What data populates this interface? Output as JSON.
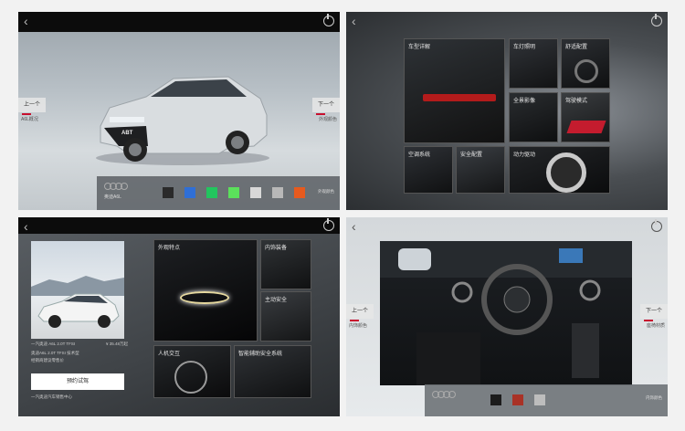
{
  "nav": {
    "prev": "上一个",
    "next": "下一个"
  },
  "panel1": {
    "left_sub": "A6L概况",
    "right_sub": "外观颜色",
    "brand": "奥迪A6L",
    "corner": "外观颜色",
    "grille_badge": "ABT",
    "swatches": [
      "#2a2a2a",
      "#2f6fd6",
      "#22c55e",
      "#5be05b",
      "#d8d8d8",
      "#b8b8b8",
      "#e65a1e"
    ]
  },
  "panel2": {
    "tiles": [
      {
        "label": "车型详解"
      },
      {
        "label": "车灯照明"
      },
      {
        "label": "舒适配置"
      },
      {
        "label": "全景影像"
      },
      {
        "label": "驾驶模式"
      },
      {
        "label": "空调系统"
      },
      {
        "label": "安全配置"
      },
      {
        "label": "动力驱动"
      }
    ]
  },
  "panel3": {
    "caption_left": "一汽奥迪 A6L 2.0T TFSI",
    "caption_right": "¥ 35.48万起",
    "info_lines": [
      "奥迪A6L 2.0T TFSI 技术型",
      "经销商建议零售价"
    ],
    "button": "预约试驾",
    "footer": "一汽奥迪汽车销售中心",
    "tiles": [
      {
        "label": "外观特点"
      },
      {
        "label": "内饰装备"
      },
      {
        "label": "主动安全"
      },
      {
        "label": "人机交互"
      },
      {
        "label": "智能辅助安全系统"
      }
    ]
  },
  "panel4": {
    "left_sub": "内饰颜色",
    "right_sub": "座椅材质",
    "corner": "内饰颜色",
    "swatches": [
      "#1c1c1c",
      "#a93226",
      "#bdbdbd"
    ]
  }
}
